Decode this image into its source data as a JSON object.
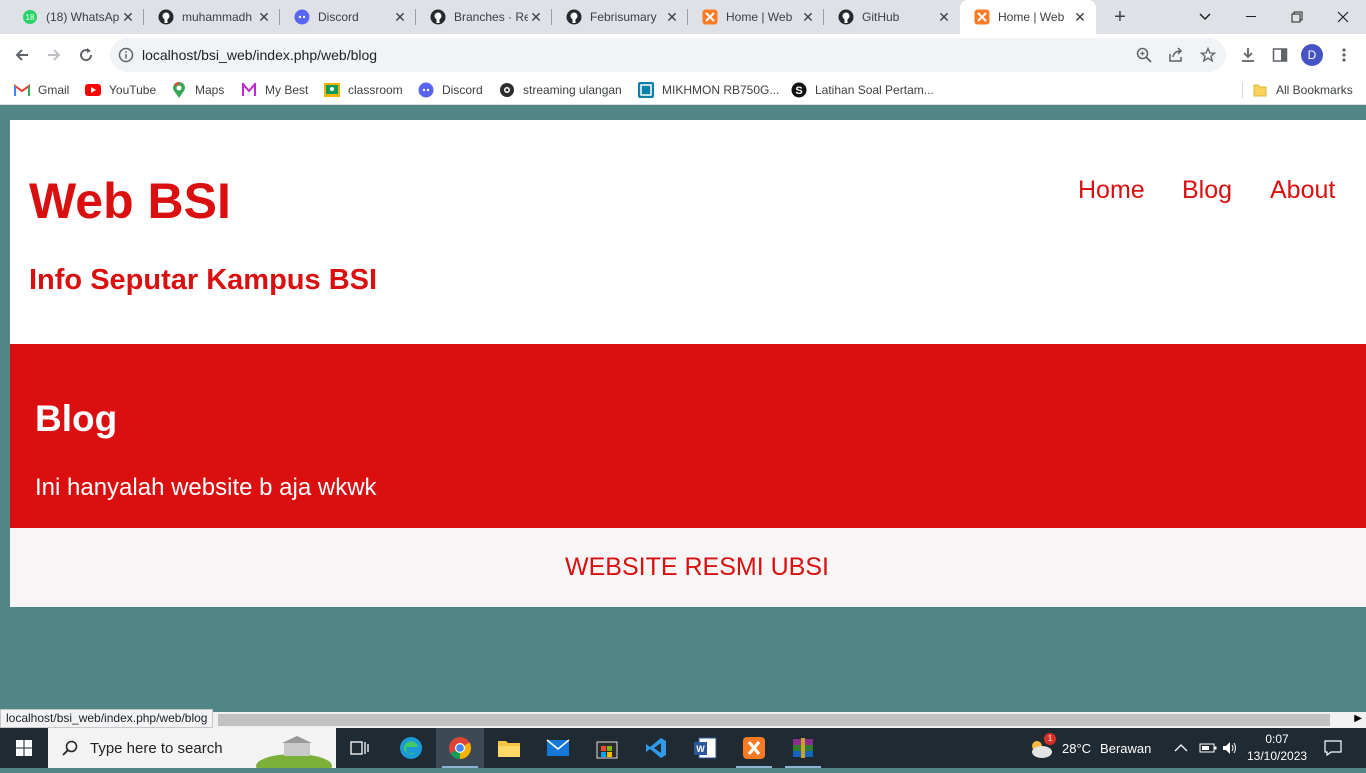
{
  "browser": {
    "tabs": [
      {
        "title": "(18) WhatsApp",
        "icon": "whatsapp-icon",
        "badge": "18"
      },
      {
        "title": "muhammadh",
        "icon": "github-icon"
      },
      {
        "title": "Discord",
        "icon": "discord-icon"
      },
      {
        "title": "Branches · Re",
        "icon": "github-icon"
      },
      {
        "title": "Febrisumary",
        "icon": "github-icon"
      },
      {
        "title": "Home | Web",
        "icon": "xampp-icon"
      },
      {
        "title": "GitHub",
        "icon": "github-icon"
      },
      {
        "title": "Home | Web",
        "icon": "xampp-icon",
        "active": true
      }
    ],
    "address": "localhost/bsi_web/index.php/web/blog",
    "profile_initial": "D",
    "bookmarks": [
      {
        "label": "Gmail",
        "icon": "gmail-icon"
      },
      {
        "label": "YouTube",
        "icon": "youtube-icon"
      },
      {
        "label": "Maps",
        "icon": "maps-icon"
      },
      {
        "label": "My Best",
        "icon": "mybest-icon"
      },
      {
        "label": "classroom",
        "icon": "classroom-icon"
      },
      {
        "label": "Discord",
        "icon": "discord-icon"
      },
      {
        "label": "streaming ulangan",
        "icon": "globe-icon"
      },
      {
        "label": "MIKHMON RB750G...",
        "icon": "mikhmon-icon"
      },
      {
        "label": "Latihan Soal Pertam...",
        "icon": "s-icon"
      }
    ],
    "all_bookmarks": "All Bookmarks",
    "status_url": "localhost/bsi_web/index.php/web/blog"
  },
  "site": {
    "title": "Web BSI",
    "subtitle": "Info Seputar Kampus BSI",
    "nav": [
      "Home",
      "Blog",
      "About"
    ],
    "hero_heading": "Blog",
    "hero_text": "Ini hanyalah website b aja wkwk",
    "footer": "WEBSITE RESMI UBSI"
  },
  "taskbar": {
    "search_placeholder": "Type here to search",
    "weather": "28°C",
    "weather_desc": "Berawan",
    "time": "0:07",
    "date": "13/10/2023",
    "weather_badge": "1"
  },
  "colors": {
    "brand_red": "#d9100f",
    "hero_red": "#db0f0f",
    "page_bg": "#528585"
  }
}
